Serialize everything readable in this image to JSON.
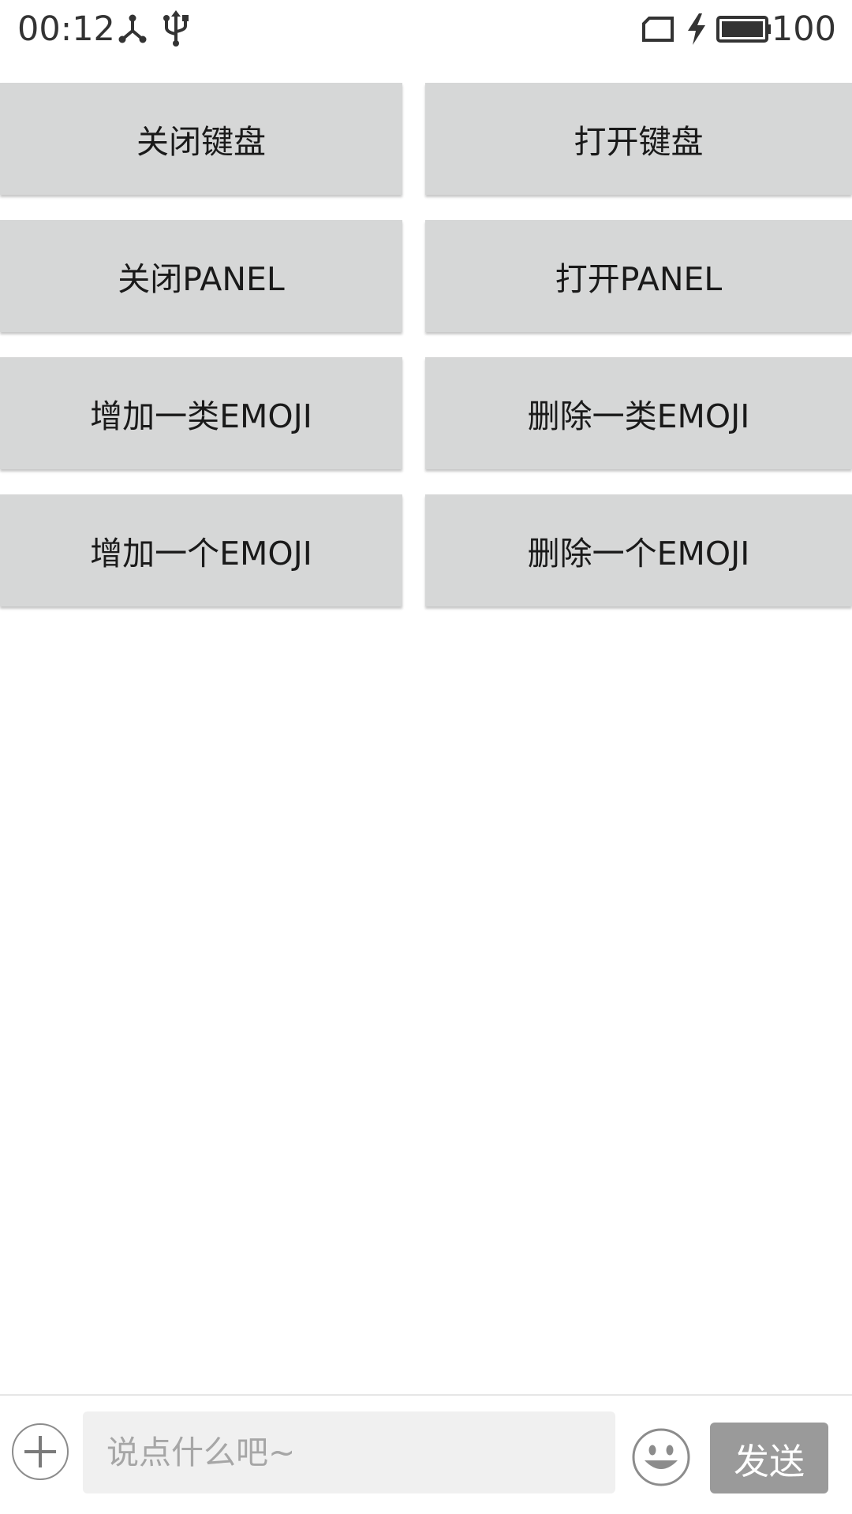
{
  "status_bar": {
    "time": "00:12",
    "battery_percent": "100",
    "icons": [
      "share-icon",
      "usb-icon",
      "sim-card-icon",
      "charging-bolt-icon",
      "battery-icon"
    ]
  },
  "buttons": {
    "close_keyboard": "关闭键盘",
    "open_keyboard": "打开键盘",
    "close_panel": "关闭PANEL",
    "open_panel": "打开PANEL",
    "add_emoji_category": "增加一类EMOJI",
    "remove_emoji_category": "删除一类EMOJI",
    "add_emoji": "增加一个EMOJI",
    "remove_emoji": "删除一个EMOJI"
  },
  "input_bar": {
    "placeholder": "说点什么吧~",
    "value": "",
    "send_label": "发送",
    "icons": [
      "plus-icon",
      "emoji-face-icon"
    ]
  },
  "colors": {
    "button_bg": "#d6d7d7",
    "input_bg": "#f0f0f0",
    "send_bg": "#9a9a9a",
    "text_dark": "#1a1a1a"
  }
}
